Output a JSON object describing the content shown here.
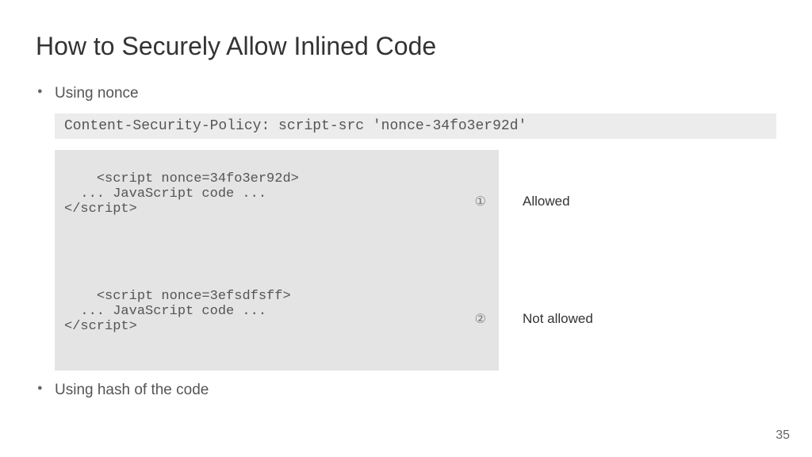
{
  "title": "How to Securely Allow Inlined Code",
  "bullets": {
    "item1": "Using nonce",
    "item2": "Using hash of the code"
  },
  "code": {
    "csp": "Content-Security-Policy: script-src 'nonce-34fo3er92d'",
    "block1": "<script nonce=34fo3er92d>\n  ... JavaScript code ...\n</script>",
    "block2": "<script nonce=3efsdfsff>\n  ... JavaScript code ...\n</script>",
    "marker1": "①",
    "marker2": "②",
    "label1": "Allowed",
    "label2": "Not allowed"
  },
  "pageNumber": "35"
}
